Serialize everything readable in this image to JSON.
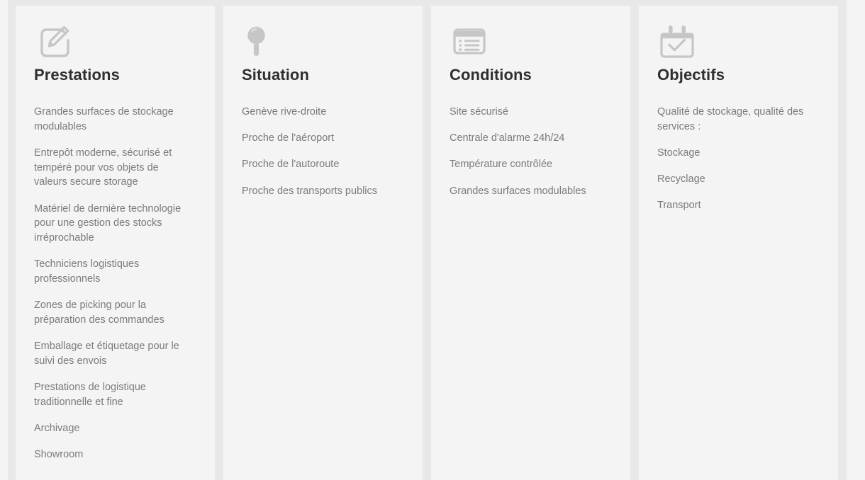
{
  "theme": {
    "page_background": "#e8e8e8",
    "card_background": "#f4f4f4",
    "heading_color": "#2f2f2f",
    "body_text_color": "#7b7b7b",
    "icon_color": "#c6c6c6"
  },
  "columns": [
    {
      "id": "prestations",
      "icon": "edit-pencil-square-icon",
      "title": "Prestations",
      "items": [
        "Grandes surfaces de stockage modulables",
        "Entrepôt moderne, sécurisé et tempéré pour vos objets de valeurs secure storage",
        "Matériel de dernière technologie pour une gestion des stocks irréprochable",
        "Techniciens logistiques professionnels",
        "Zones de picking pour la préparation des commandes",
        "Emballage et étiquetage pour le suivi des envois",
        "Prestations de logistique traditionnelle et fine",
        "Archivage",
        "Showroom"
      ]
    },
    {
      "id": "situation",
      "icon": "map-pin-icon",
      "title": "Situation",
      "items": [
        "Genève rive-droite",
        "Proche de l'aéroport",
        "Proche de l'autoroute",
        "Proche des transports publics"
      ]
    },
    {
      "id": "conditions",
      "icon": "list-window-icon",
      "title": "Conditions",
      "items": [
        "Site sécurisé",
        "Centrale d'alarme 24h/24",
        "Température contrôlée",
        "Grandes surfaces modulables"
      ]
    },
    {
      "id": "objectifs",
      "icon": "calendar-check-icon",
      "title": "Objectifs",
      "items": [
        "Qualité de stockage, qualité des services :",
        "Stockage",
        "Recyclage",
        "Transport"
      ]
    }
  ]
}
